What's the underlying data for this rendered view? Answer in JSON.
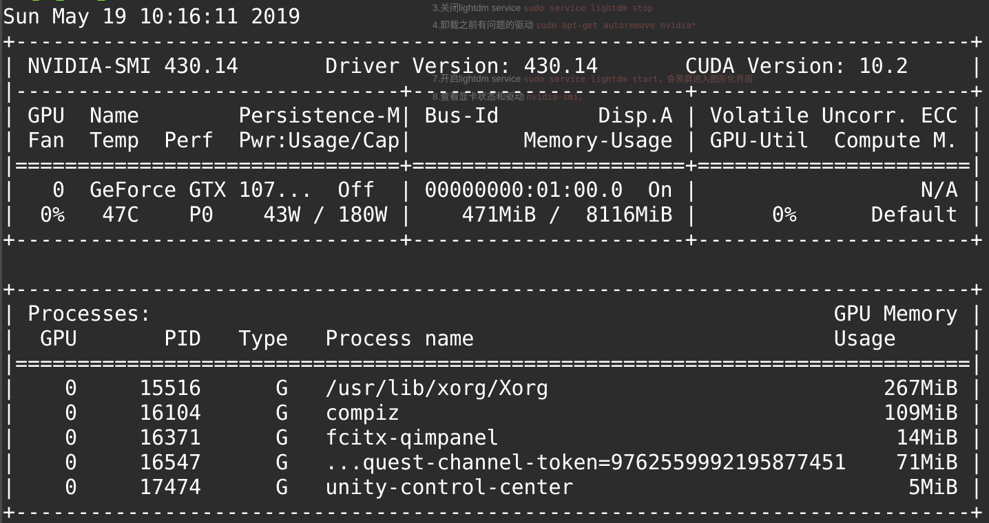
{
  "timestamp_line": "Sun May 19 10:16:11 2019",
  "background_notes": [
    {
      "text": "3.关闭lightdm service ",
      "code": "sudo service lightdm stop"
    },
    {
      "text": "4.卸载之前有问题的驱动 ",
      "code": "sudo apt-get autoremove nvidia*"
    },
    {
      "text": "",
      "code": ""
    },
    {
      "text": "",
      "code": ""
    },
    {
      "text": "7.开启lightdm service ",
      "code": "sudo service lightdm start，会黑屏进入图形化界面"
    },
    {
      "text": "8.查看显卡状态和驱动 ",
      "code": "nvidia-smi，"
    }
  ],
  "summary_table": {
    "border_top": "+-----------------------------------------------------------------------------+",
    "header_line": "| NVIDIA-SMI 430.14       Driver Version: 430.14       CUDA Version: 10.2     |",
    "separator_1": "|-------------------------------+----------------------+----------------------+",
    "column_header_1": "| GPU  Name        Persistence-M| Bus-Id        Disp.A | Volatile Uncorr. ECC |",
    "column_header_2": "| Fan  Temp  Perf  Pwr:Usage/Cap|         Memory-Usage | GPU-Util  Compute M. |",
    "separator_2": "|===============================+======================+======================|",
    "gpu_row_1": "|   0  GeForce GTX 107...  Off  | 00000000:01:00.0  On |                  N/A |",
    "gpu_row_2": "|  0%   47C    P0    43W / 180W |    471MiB /  8116MiB |      0%      Default |",
    "border_bottom": "+-------------------------------+----------------------+----------------------+"
  },
  "processes_table": {
    "border_top": "+-----------------------------------------------------------------------------+",
    "title_line": "| Processes:                                                       GPU Memory |",
    "column_header": "|  GPU       PID   Type   Process name                             Usage      |",
    "separator": "|=============================================================================|",
    "rows": [
      "|    0     15516      G   /usr/lib/xorg/Xorg                           267MiB |",
      "|    0     16104      G   compiz                                       109MiB |",
      "|    0     16371      G   fcitx-qimpanel                                14MiB |",
      "|    0     16547      G   ...quest-channel-token=9762559992195877451    71MiB |",
      "|    0     17474      G   unity-control-center                           5MiB |"
    ],
    "border_bottom": "+-----------------------------------------------------------------------------+"
  },
  "colors": {
    "background": "#2c2c2c",
    "text": "#ffffff",
    "prompt_green": "#8ae234"
  }
}
